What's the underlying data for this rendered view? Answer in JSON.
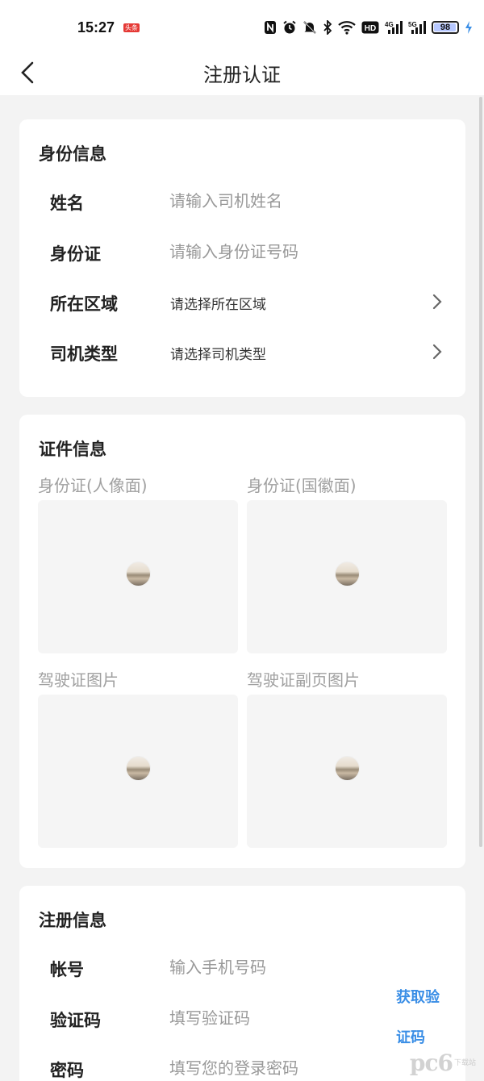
{
  "status_bar": {
    "time": "15:27",
    "badge": "头条",
    "network_4g": "4G",
    "network_5g": "5G",
    "hd_label": "HD",
    "battery_level": 98,
    "battery_text": "98"
  },
  "nav": {
    "title": "注册认证"
  },
  "identity": {
    "section_title": "身份信息",
    "name_label": "姓名",
    "name_placeholder": "请输入司机姓名",
    "id_label": "身份证",
    "id_placeholder": "请输入身份证号码",
    "region_label": "所在区域",
    "region_value": "请选择所在区域",
    "driver_type_label": "司机类型",
    "driver_type_value": "请选择司机类型"
  },
  "documents": {
    "section_title": "证件信息",
    "items": [
      {
        "label": "身份证(人像面)"
      },
      {
        "label": "身份证(国徽面)"
      },
      {
        "label": "驾驶证图片"
      },
      {
        "label": "驾驶证副页图片"
      }
    ]
  },
  "registration": {
    "section_title": "注册信息",
    "account_label": "帐号",
    "account_placeholder": "输入手机号码",
    "code_label": "验证码",
    "code_placeholder": "填写验证码",
    "get_code_button": "获取验证码",
    "password_label": "密码",
    "password_placeholder": "填写您的登录密码"
  },
  "watermark": {
    "main": "pc6",
    "sub": "下载站"
  },
  "colors": {
    "page_bg": "#f3f3f3",
    "card_bg": "#ffffff",
    "accent": "#3a8ee6",
    "placeholder": "#999999",
    "upload_bg": "#f5f5f5"
  }
}
